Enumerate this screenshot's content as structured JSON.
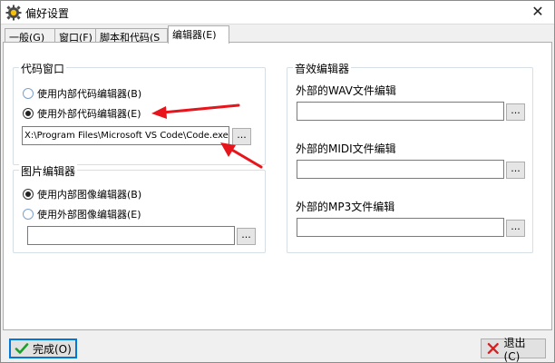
{
  "window": {
    "title": "偏好设置"
  },
  "tabs": [
    {
      "label": "一般(G)",
      "active": false
    },
    {
      "label": "窗口(F)",
      "active": false
    },
    {
      "label": "脚本和代码(S",
      "active": false
    },
    {
      "label": "编辑器(E)",
      "active": true
    }
  ],
  "code_window": {
    "title": "代码窗口",
    "options": [
      {
        "label": "使用内部代码编辑器(B)",
        "checked": false
      },
      {
        "label": "使用外部代码编辑器(E)",
        "checked": true
      }
    ],
    "path_value": "X:\\Program Files\\Microsoft VS Code\\Code.exe",
    "browse_label": "..."
  },
  "image_editor": {
    "title": "图片编辑器",
    "options": [
      {
        "label": "使用内部图像编辑器(B)",
        "checked": true
      },
      {
        "label": "使用外部图像编辑器(E)",
        "checked": false
      }
    ],
    "path_value": "",
    "browse_label": "..."
  },
  "sound_editor": {
    "title": "音效编辑器",
    "fields": [
      {
        "label": "外部的WAV文件编辑",
        "value": "",
        "browse_label": "..."
      },
      {
        "label": "外部的MIDI文件编辑",
        "value": "",
        "browse_label": "..."
      },
      {
        "label": "外部的MP3文件编辑",
        "value": "",
        "browse_label": "..."
      }
    ]
  },
  "footer": {
    "ok_label": "完成(O)",
    "cancel_label": "退出(C)"
  },
  "colors": {
    "accent": "#0078d7",
    "arrow": "#e8141c",
    "ok_check": "#1e9e2e",
    "cancel_x": "#d42020"
  },
  "icons": {
    "app": "gear-icon",
    "close": "close-icon",
    "ok": "checkmark-icon",
    "cancel": "x-icon"
  }
}
